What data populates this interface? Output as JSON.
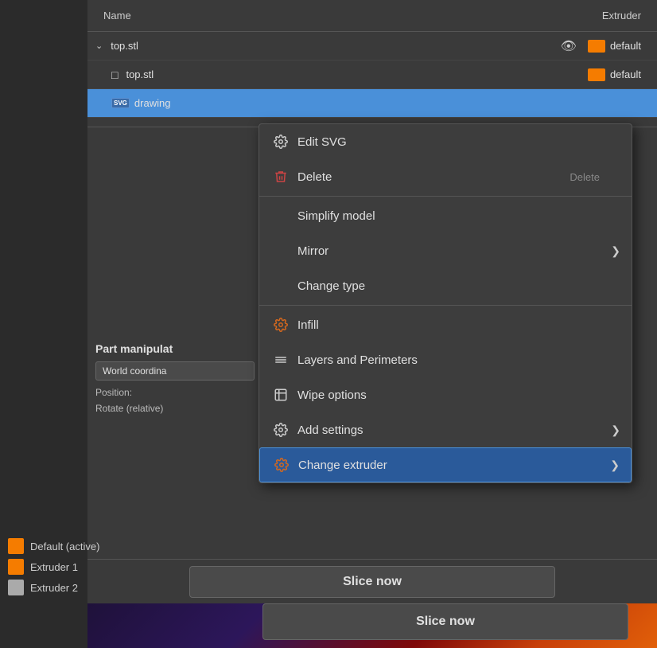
{
  "header": {
    "name_col": "Name",
    "extruder_col": "Extruder"
  },
  "files": [
    {
      "id": "top-stl-parent",
      "name": "top.stl",
      "indent": 0,
      "hasChevron": true,
      "hasEye": true,
      "colorBox": true,
      "extruderLabel": "default",
      "selected": false
    },
    {
      "id": "top-stl-child",
      "name": "top.stl",
      "indent": 1,
      "hasChevron": false,
      "hasEye": false,
      "colorBox": true,
      "extruderLabel": "default",
      "selected": false
    },
    {
      "id": "drawing-svg",
      "name": "drawing",
      "indent": 1,
      "hasChevron": false,
      "hasEye": false,
      "isSVG": true,
      "colorBox": false,
      "extruderLabel": "",
      "selected": true
    }
  ],
  "context_menu": {
    "items": [
      {
        "id": "edit-svg",
        "label": "Edit SVG",
        "icon": "gear",
        "shortcut": "",
        "hasArrow": false,
        "separator_after": false
      },
      {
        "id": "delete",
        "label": "Delete",
        "icon": "trash",
        "shortcut": "Delete",
        "hasArrow": false,
        "separator_after": true
      },
      {
        "id": "simplify-model",
        "label": "Simplify model",
        "icon": "",
        "shortcut": "",
        "hasArrow": false,
        "separator_after": false
      },
      {
        "id": "mirror",
        "label": "Mirror",
        "icon": "",
        "shortcut": "",
        "hasArrow": true,
        "separator_after": false
      },
      {
        "id": "change-type",
        "label": "Change type",
        "icon": "",
        "shortcut": "",
        "hasArrow": false,
        "separator_after": true
      },
      {
        "id": "infill",
        "label": "Infill",
        "icon": "infill",
        "shortcut": "",
        "hasArrow": false,
        "separator_after": false
      },
      {
        "id": "layers-perimeters",
        "label": "Layers and Perimeters",
        "icon": "layers",
        "shortcut": "",
        "hasArrow": false,
        "separator_after": false
      },
      {
        "id": "wipe-options",
        "label": "Wipe options",
        "icon": "wipe",
        "shortcut": "",
        "hasArrow": false,
        "separator_after": false
      },
      {
        "id": "add-settings",
        "label": "Add settings",
        "icon": "gear",
        "shortcut": "",
        "hasArrow": true,
        "separator_after": false
      },
      {
        "id": "change-extruder",
        "label": "Change extruder",
        "icon": "extruder",
        "shortcut": "",
        "hasArrow": true,
        "highlighted": true,
        "separator_after": false
      }
    ]
  },
  "part_manipulator": {
    "title": "Part manipulat",
    "coordinate_label": "World coordina",
    "position_label": "Position:",
    "rotate_label": "Rotate (relative)"
  },
  "legend": {
    "items": [
      {
        "label": "Default (active)",
        "color": "#f57c00"
      },
      {
        "label": "Extruder 1",
        "color": "#f57c00"
      },
      {
        "label": "Extruder 2",
        "color": "#f57c00"
      }
    ]
  },
  "slice_button": {
    "label": "Slice now"
  }
}
